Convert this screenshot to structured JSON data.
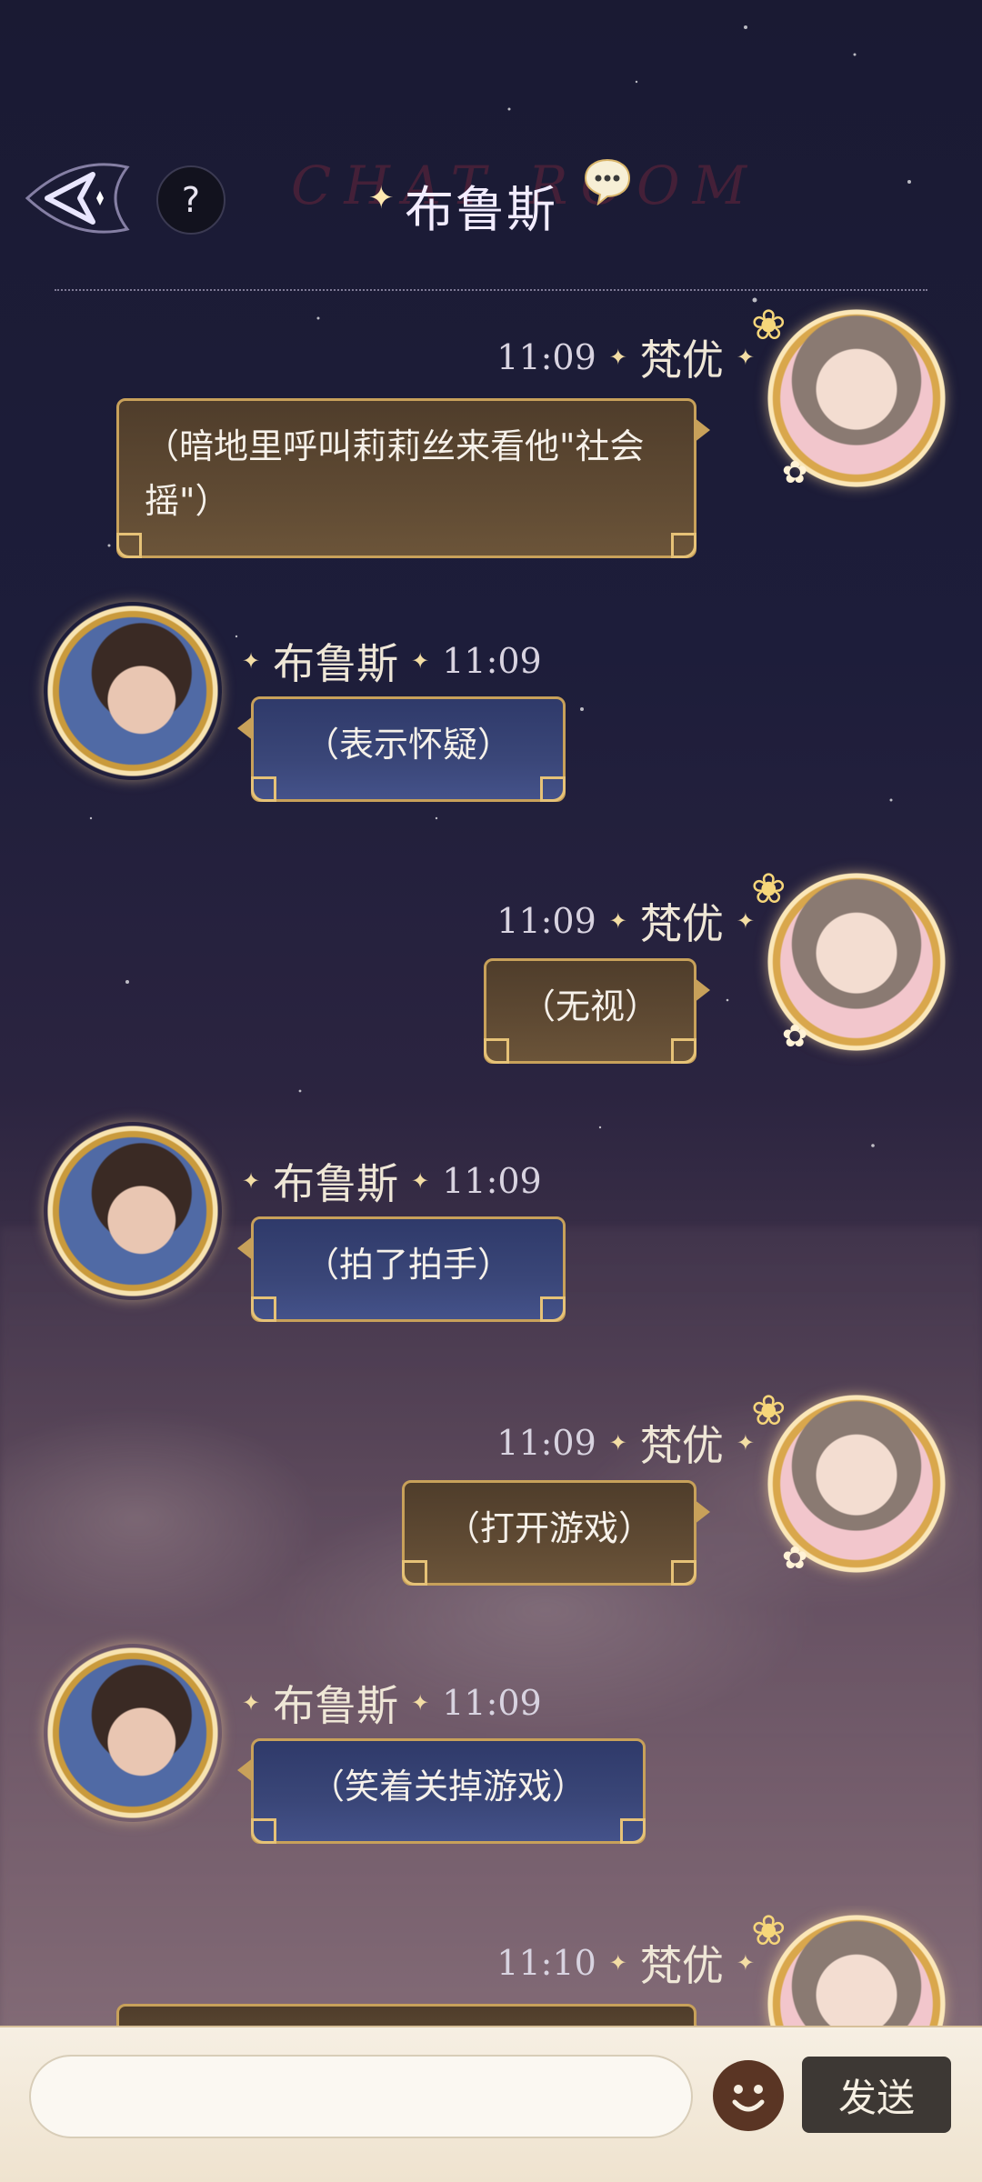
{
  "header": {
    "title": "布鲁斯",
    "room_watermark": "CHAT ROOM",
    "help_label": "?"
  },
  "messages": [
    {
      "sender": "梵优",
      "side": "right",
      "time": "11:09",
      "text": "（暗地里呼叫莉莉丝来看他\"社会摇\"）"
    },
    {
      "sender": "布鲁斯",
      "side": "left",
      "time": "11:09",
      "text": "（表示怀疑）"
    },
    {
      "sender": "梵优",
      "side": "right",
      "time": "11:09",
      "text": "（无视）"
    },
    {
      "sender": "布鲁斯",
      "side": "left",
      "time": "11:09",
      "text": "（拍了拍手）"
    },
    {
      "sender": "梵优",
      "side": "right",
      "time": "11:09",
      "text": "（打开游戏）"
    },
    {
      "sender": "布鲁斯",
      "side": "left",
      "time": "11:09",
      "text": "（笑着关掉游戏）"
    },
    {
      "sender": "梵优",
      "side": "right",
      "time": "11:10",
      "text": ""
    }
  ],
  "input": {
    "placeholder": "",
    "send_label": "发送"
  },
  "icons": {
    "back": "back-arrow-icon",
    "help": "help-icon",
    "chat": "chat-bubble-icon",
    "emoji": "emoji-icon"
  },
  "colors": {
    "bubble_right": "#5f4a33",
    "bubble_left": "#3a4678",
    "gold_border": "#c8a15a",
    "send_button": "#3d3834"
  }
}
